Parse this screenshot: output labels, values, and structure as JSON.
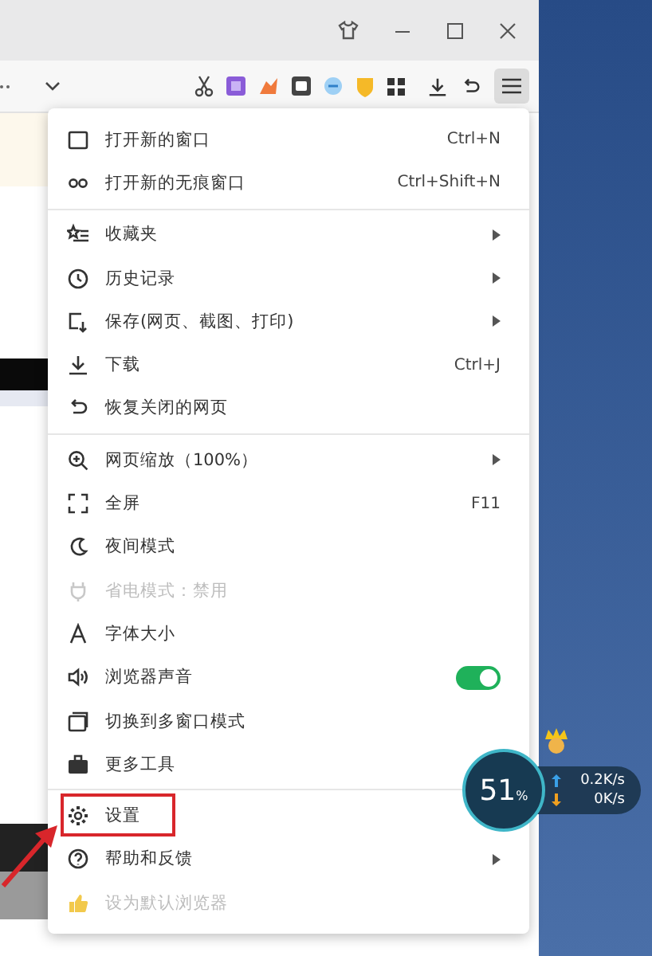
{
  "menu": {
    "groups": [
      [
        {
          "label": "打开新的窗口",
          "shortcut": "Ctrl+N",
          "submenu": false,
          "disabled": false,
          "highlighted": false
        },
        {
          "label": "打开新的无痕窗口",
          "shortcut": "Ctrl+Shift+N",
          "submenu": false,
          "disabled": false,
          "highlighted": false
        }
      ],
      [
        {
          "label": "收藏夹",
          "submenu": true,
          "disabled": false,
          "highlighted": false
        },
        {
          "label": "历史记录",
          "submenu": true,
          "disabled": false,
          "highlighted": false
        },
        {
          "label": "保存(网页、截图、打印)",
          "submenu": true,
          "disabled": false,
          "highlighted": false
        },
        {
          "label": "下载",
          "shortcut": "Ctrl+J",
          "submenu": false,
          "disabled": false,
          "highlighted": false
        },
        {
          "label": "恢复关闭的网页",
          "submenu": false,
          "disabled": false,
          "highlighted": false
        }
      ],
      [
        {
          "label": "网页缩放（100%）",
          "submenu": true,
          "disabled": false,
          "highlighted": false
        },
        {
          "label": "全屏",
          "shortcut": "F11",
          "submenu": false,
          "disabled": false,
          "highlighted": false
        },
        {
          "label": "夜间模式",
          "submenu": false,
          "disabled": false,
          "highlighted": false
        },
        {
          "label": "省电模式：禁用",
          "submenu": false,
          "disabled": true,
          "highlighted": false
        },
        {
          "label": "字体大小",
          "submenu": false,
          "disabled": false,
          "highlighted": false
        },
        {
          "label": "浏览器声音",
          "submenu": false,
          "disabled": false,
          "highlighted": false,
          "toggle": {
            "on": true
          }
        },
        {
          "label": "切换到多窗口模式",
          "submenu": false,
          "disabled": false,
          "highlighted": false
        },
        {
          "label": "更多工具",
          "disabled": false,
          "highlighted": false
        }
      ],
      [
        {
          "label": "设置",
          "submenu": false,
          "disabled": false,
          "highlighted": true
        },
        {
          "label": "帮助和反馈",
          "submenu": true,
          "disabled": false,
          "highlighted": false
        },
        {
          "label": "设为默认浏览器",
          "submenu": false,
          "disabled": true,
          "highlighted": false
        }
      ]
    ]
  },
  "net_widget": {
    "percent": "51",
    "percent_sign": "%",
    "upload": "0.2K/s",
    "download": "0K/s"
  }
}
